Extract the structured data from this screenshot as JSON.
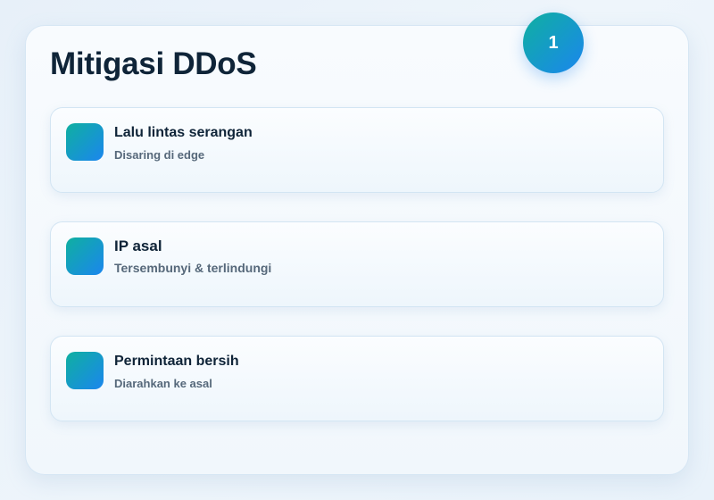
{
  "badge": {
    "number": "1"
  },
  "title": "Mitigasi DDoS",
  "accent_gradient": [
    "#0fb0a0",
    "#1b86ee"
  ],
  "items": [
    {
      "icon": "gradient-square-icon",
      "title": "Lalu lintas serangan",
      "subtitle": "Disaring di edge"
    },
    {
      "icon": "gradient-square-icon",
      "title": "IP asal",
      "subtitle": "Tersembunyi & terlindungi"
    },
    {
      "icon": "gradient-square-icon",
      "title": "Permintaan bersih",
      "subtitle": "Diarahkan ke asal"
    }
  ]
}
